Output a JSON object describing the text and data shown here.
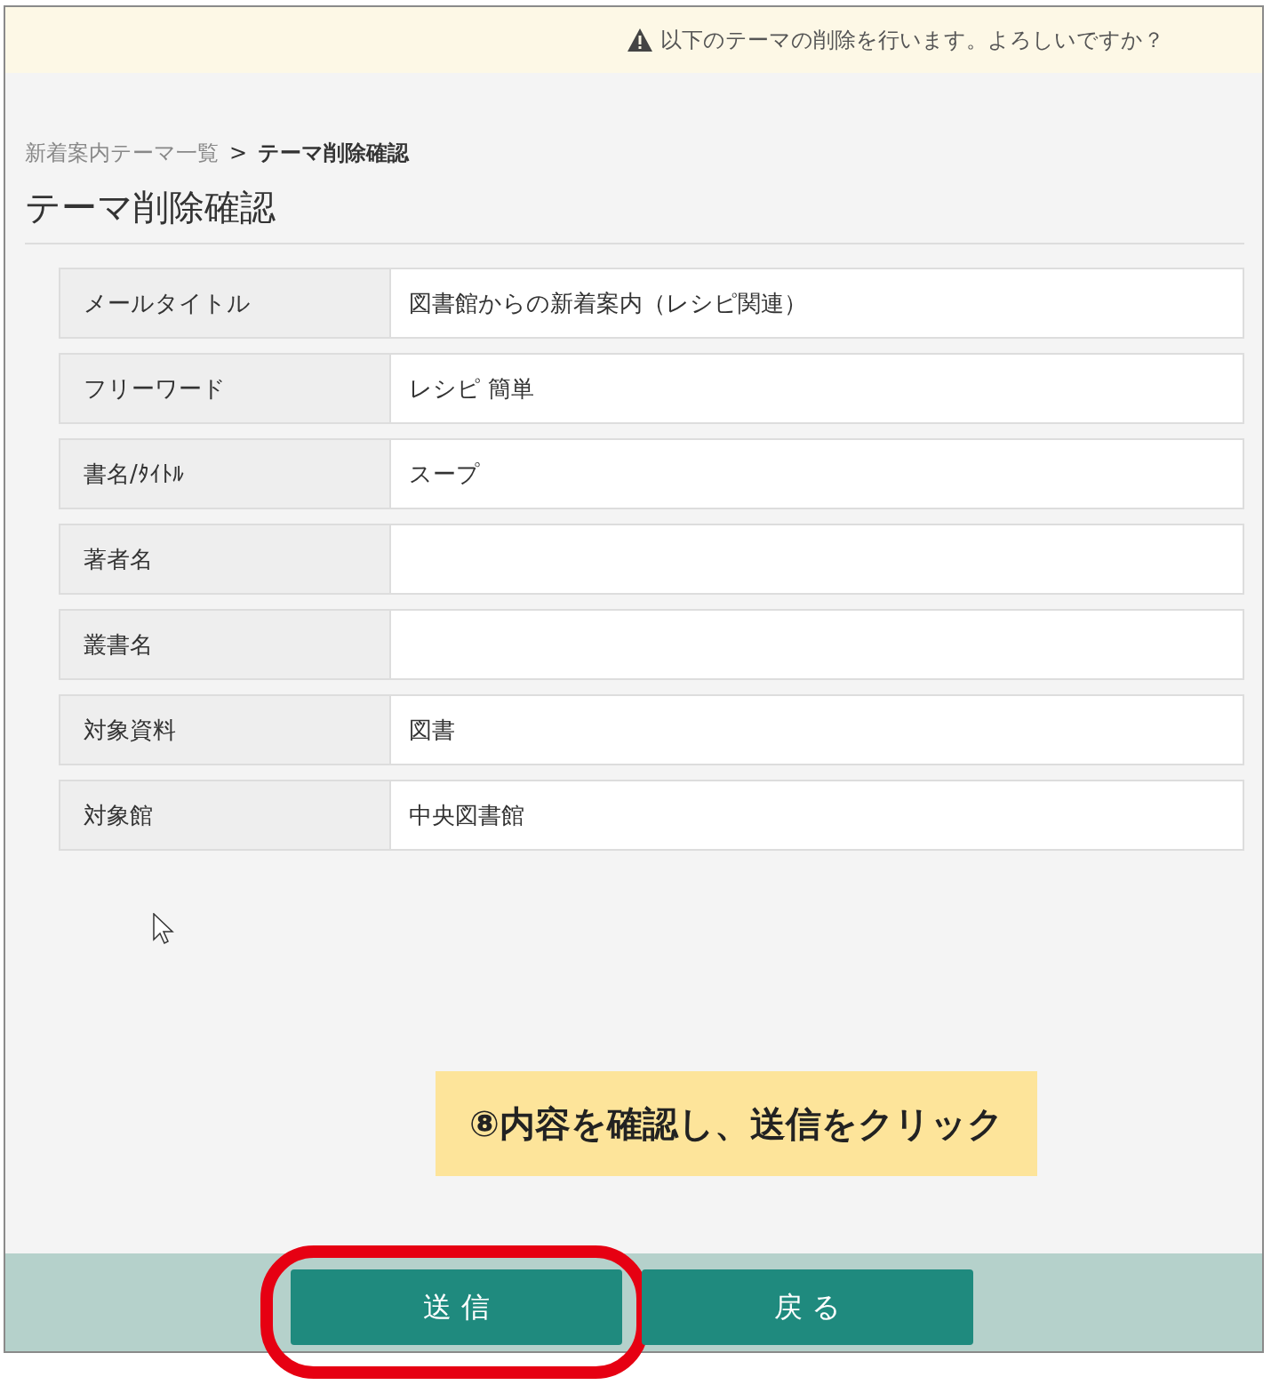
{
  "warning": {
    "text": "以下のテーマの削除を行います。よろしいですか？"
  },
  "breadcrumb": [
    {
      "label": "新着案内テーマ一覧",
      "kind": "link"
    },
    {
      "label": ">",
      "kind": "separator"
    },
    {
      "label": "テーマ削除確認",
      "kind": "current"
    }
  ],
  "page_title": "テーマ削除確認",
  "fields": [
    {
      "label": "メールタイトル",
      "value": "図書館からの新着案内（レシピ関連）"
    },
    {
      "label": "フリーワード",
      "value": "レシピ 簡単"
    },
    {
      "label": "書名/ﾀｲﾄﾙ",
      "value": "スープ"
    },
    {
      "label": "著者名"
    },
    {
      "label": "叢書名"
    },
    {
      "label": "対象資料",
      "value": "図書"
    },
    {
      "label": "対象館",
      "value": "中央図書館"
    }
  ],
  "callout": {
    "text": "⑧内容を確認し、送信をクリック"
  },
  "buttons": [
    {
      "label": "送 信",
      "highlighted": true
    },
    {
      "label": "戻 る",
      "highlighted": false
    }
  ]
}
